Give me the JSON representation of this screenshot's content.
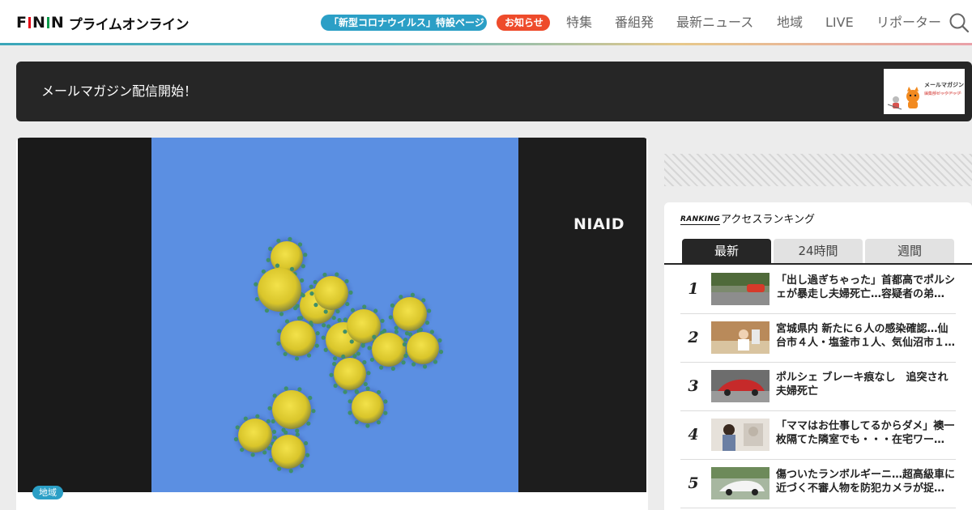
{
  "header": {
    "logo_text": "FNNプライムオンライン",
    "logo_fnn": [
      "F",
      "N",
      "N"
    ],
    "logo_jp": "プライムオンライン",
    "pill_corona": "「新型コロナウイルス」特設ページ",
    "pill_notice": "お知らせ",
    "nav": [
      "特集",
      "番組発",
      "最新ニュース",
      "地域",
      "LIVE",
      "リポーター"
    ]
  },
  "banner": {
    "text": "メールマガジン配信開始！",
    "thumb_label": "メールマガジン",
    "thumb_sub": "編集部ピックアップ"
  },
  "article": {
    "image_caption": "NIAID",
    "category": "地域"
  },
  "ranking": {
    "logo": "RANKING",
    "title": "アクセスランキング",
    "tabs": [
      "最新",
      "24時間",
      "週間"
    ],
    "active_tab": "最新",
    "items": [
      {
        "rank": "1",
        "title": "「出し過ぎちゃった」首都高でポルシェが暴走し夫婦死亡…容疑者の弟…"
      },
      {
        "rank": "2",
        "title": "宮城県内 新たに６人の感染確認…仙台市４人・塩釜市１人、気仙沼市１…"
      },
      {
        "rank": "3",
        "title": "ポルシェ ブレーキ痕なし　追突され夫婦死亡"
      },
      {
        "rank": "4",
        "title": "「ママはお仕事してるからダメ」襖一枚隔てた隣室でも・・・在宅ワー…"
      },
      {
        "rank": "5",
        "title": "傷ついたランボルギーニ…超高級車に近づく不審人物を防犯カメラが捉…"
      }
    ]
  },
  "colors": {
    "accent_blue": "#2b9fc6",
    "notice_red": "#ee4b2b",
    "dark": "#262626"
  }
}
